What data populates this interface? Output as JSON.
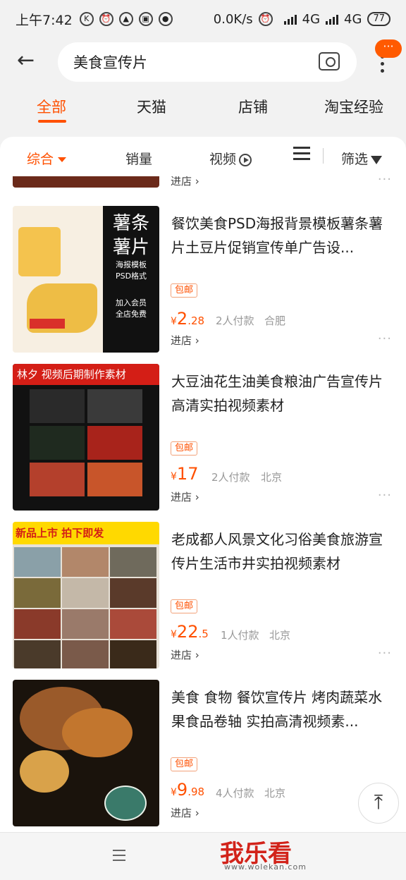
{
  "status": {
    "time": "上午7:42",
    "network_speed": "0.0K/s",
    "net1": "4G",
    "net2": "4G",
    "battery": "77"
  },
  "search": {
    "query": "美食宣传片"
  },
  "header": {
    "badge": "···"
  },
  "tabs": [
    {
      "label": "全部"
    },
    {
      "label": "天猫"
    },
    {
      "label": "店铺"
    },
    {
      "label": "淘宝经验"
    }
  ],
  "filters": {
    "sort": "综合",
    "sales": "销量",
    "video": "视频",
    "filter": "筛选"
  },
  "partial_item": {
    "store": "进店 ›"
  },
  "items": [
    {
      "title": "餐饮美食PSD海报背景模板薯条薯片土豆片促销宣传单广告设...",
      "tag": "包邮",
      "price_cur": "¥",
      "price_int": "2",
      "price_dec": ".28",
      "sold": "2人付款",
      "location": "合肥",
      "store": "进店 ›",
      "thumb_text": {
        "big": "薯条薯片",
        "line1": "海报模板",
        "line2": "PSD格式",
        "line3": "加入会员",
        "line4": "全店免费"
      }
    },
    {
      "title": "大豆油花生油美食粮油广告宣传片高清实拍视频素材",
      "tag": "包邮",
      "price_cur": "¥",
      "price_int": "17",
      "price_dec": "",
      "sold": "2人付款",
      "location": "北京",
      "store": "进店 ›",
      "thumb_text": {
        "banner": "林夕 视频后期制作素材"
      }
    },
    {
      "title": "老成都人风景文化习俗美食旅游宣传片生活市井实拍视频素材",
      "tag": "包邮",
      "price_cur": "¥",
      "price_int": "22",
      "price_dec": ".5",
      "sold": "1人付款",
      "location": "北京",
      "store": "进店 ›",
      "thumb_text": {
        "banner": "新品上市 拍下即发"
      }
    },
    {
      "title": "美食 食物 餐饮宣传片 烤肉蔬菜水果食品卷轴 实拍高清视频素...",
      "tag": "包邮",
      "price_cur": "¥",
      "price_int": "9",
      "price_dec": ".98",
      "sold": "4人付款",
      "location": "北京",
      "store": "进店 ›"
    }
  ],
  "watermark": {
    "brand": "我乐看",
    "url": "www.wolekan.com"
  }
}
